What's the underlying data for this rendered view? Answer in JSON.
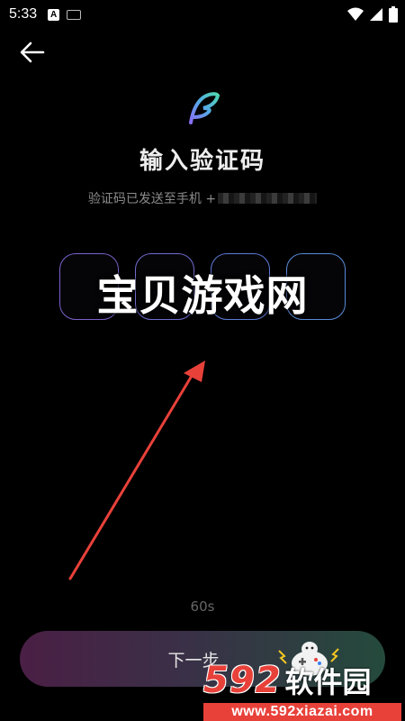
{
  "status_bar": {
    "time": "5:33",
    "app_icon_letter": "A"
  },
  "header": {
    "title": "输入验证码",
    "subtitle": "验证码已发送至手机 +",
    "back_icon": "arrow-left-icon"
  },
  "code_input": {
    "digits": [
      "",
      "",
      "",
      ""
    ]
  },
  "overlay": {
    "watermark_text": "宝贝游戏网"
  },
  "countdown": "60s",
  "next_button": {
    "label": "下一步"
  },
  "site_watermark": {
    "number": "592",
    "name": "软件园",
    "url": "www.592xiazai.com"
  },
  "colors": {
    "background": "#000000",
    "arrow": "#e8413a",
    "code_box_border": "#6b6ecf"
  }
}
